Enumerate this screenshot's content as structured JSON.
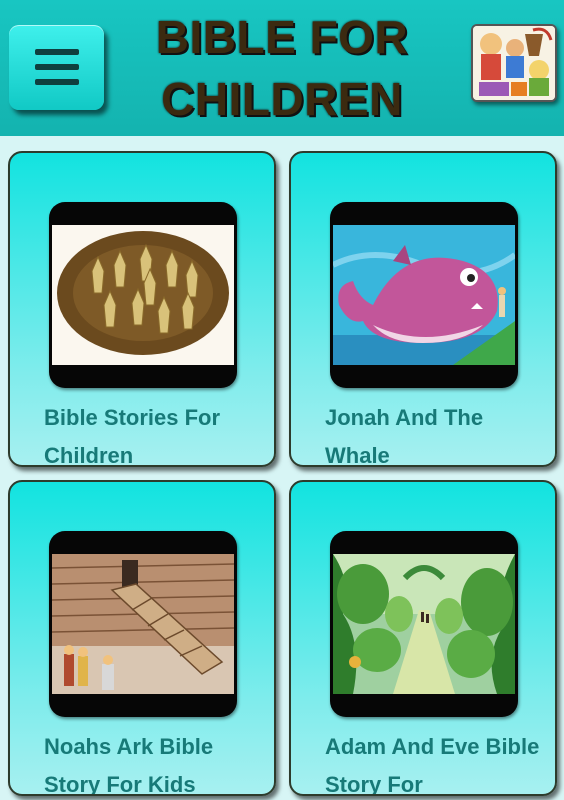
{
  "header": {
    "title_line1": "BIBLE FOR",
    "title_line2": "CHILDREN",
    "menu_icon": "hamburger-menu-icon",
    "logo_icon": "bible-stories-collage-logo"
  },
  "cards": [
    {
      "title": "Bible Stories For Children",
      "thumbnail": "wheat-sheaves-bowing"
    },
    {
      "title": "Jonah And The Whale",
      "thumbnail": "pink-whale"
    },
    {
      "title": "Noahs Ark Bible Story For Kids",
      "thumbnail": "noahs-ark-ramp"
    },
    {
      "title": "Adam And Eve Bible Story For",
      "thumbnail": "garden-of-eden-path"
    }
  ],
  "colors": {
    "header_bg": "#14b3af",
    "card_bg": "#12e3e0",
    "card_title": "#177a78",
    "title_text": "#3b2a10"
  }
}
